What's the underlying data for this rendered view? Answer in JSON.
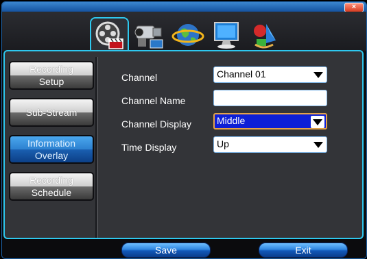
{
  "window": {
    "close_label": "×"
  },
  "tabs": [
    {
      "icon": "video-camera-clapper-icon",
      "active": true
    },
    {
      "icon": "camcorder-icon",
      "active": false
    },
    {
      "icon": "globe-network-icon",
      "active": false
    },
    {
      "icon": "monitor-icon",
      "active": false
    },
    {
      "icon": "shapes-tools-icon",
      "active": false
    }
  ],
  "sidebar": {
    "items": [
      {
        "line1": "Recording",
        "line2": "Setup",
        "active": false
      },
      {
        "line1": "Sub-Stream",
        "line2": "",
        "active": false
      },
      {
        "line1": "Information",
        "line2": "Overlay",
        "active": true
      },
      {
        "line1": "Recording",
        "line2": "Schedule",
        "active": false
      }
    ]
  },
  "form": {
    "channel": {
      "label": "Channel",
      "value": "Channel 01"
    },
    "channel_name": {
      "label": "Channel Name",
      "value": ""
    },
    "channel_display": {
      "label": "Channel Display",
      "value": "Middle"
    },
    "time_display": {
      "label": "Time Display",
      "value": "Up"
    }
  },
  "buttons": {
    "save": "Save",
    "exit": "Exit"
  },
  "colors": {
    "accent": "#2ec8ef",
    "titlebar": "#1e63a8",
    "focus_field": "#0d1fd6",
    "focus_border": "#e3a24a"
  }
}
